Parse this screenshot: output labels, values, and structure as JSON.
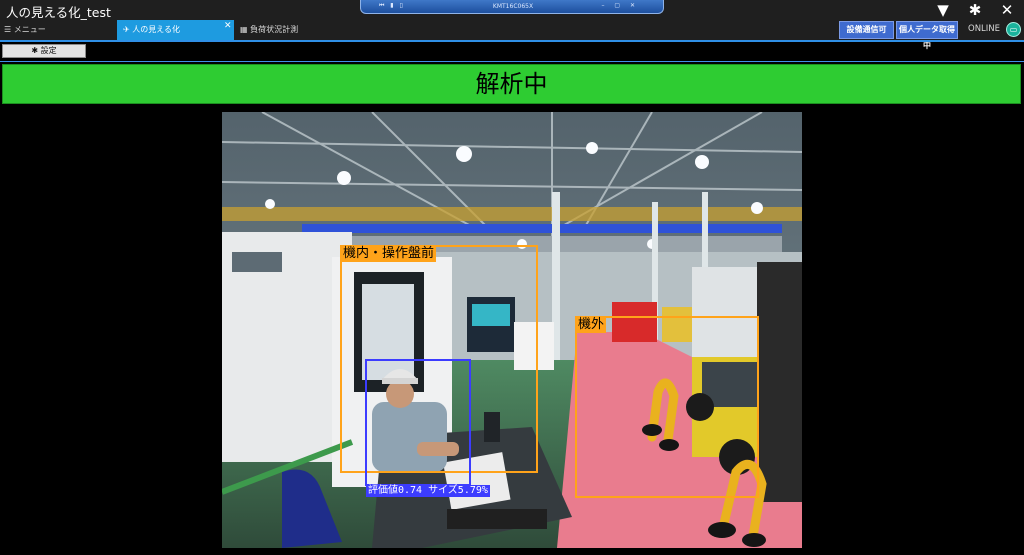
{
  "window": {
    "title": "人の見える化_test"
  },
  "remote_session": {
    "title": "KMT16C065X",
    "left_glyphs": "⏮ ▮ ▯",
    "right_glyphs": "– ▢ ✕"
  },
  "top_icons": {
    "dropdown": "▼",
    "settings": "✱",
    "close": "✕"
  },
  "tabs": [
    {
      "icon": "☰",
      "label": "メニュー"
    },
    {
      "icon": "✈",
      "label": "人の見える化",
      "active": true
    },
    {
      "icon": "▦",
      "label": "負荷状況計測"
    }
  ],
  "tab_close_glyph": "✕",
  "status_buttons": {
    "equipment": "設備通信可",
    "personal": "個人データ取得中"
  },
  "connection": {
    "label": "ONLINE",
    "icon": "▭"
  },
  "toolbar": {
    "settings_label": "✱ 設定"
  },
  "banner": {
    "text": "解析中",
    "color": "#2ecc32"
  },
  "camera": {
    "detections": [
      {
        "label": "機内・操作盤前",
        "color": "#ffa31a"
      },
      {
        "label": "機外",
        "color": "#ffa31a"
      }
    ],
    "person": {
      "score_text": "評価値0.74 サイズ5.79%",
      "color": "#3c3cff"
    }
  },
  "colors": {
    "accent": "#1e9be0",
    "status_button": "#3f6bcf",
    "banner": "#2ecc32"
  }
}
